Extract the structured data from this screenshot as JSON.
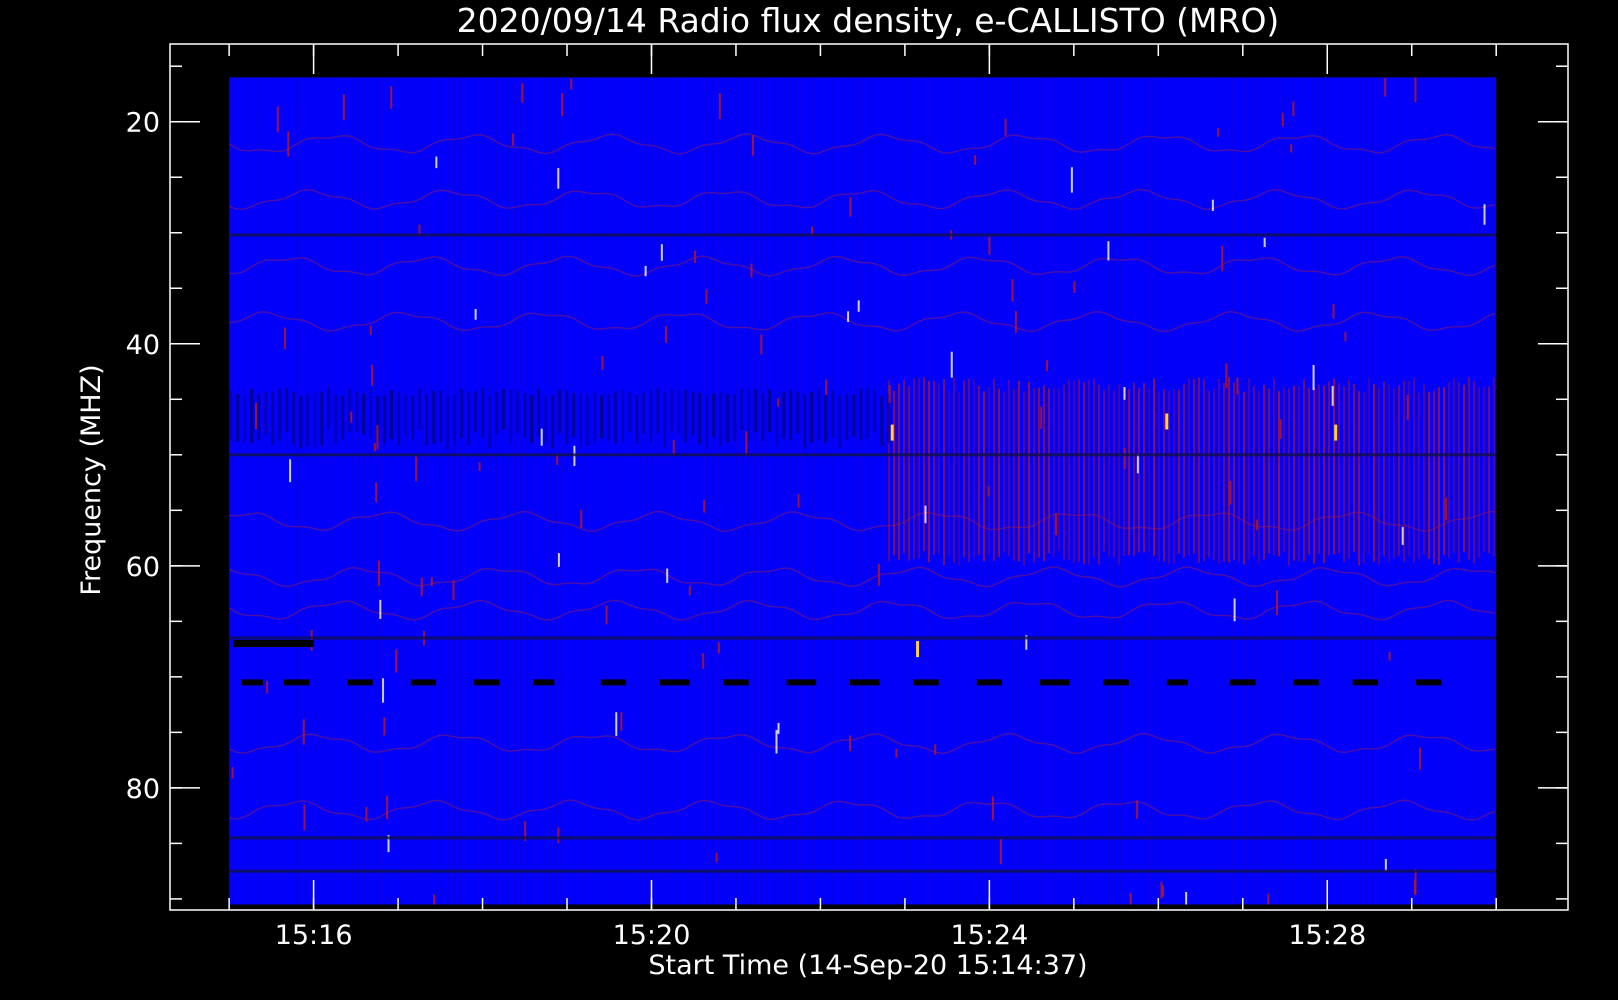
{
  "chart_data": {
    "type": "heatmap",
    "title": "2020/09/14  Radio flux density, e-CALLISTO (MRO)",
    "xlabel": "Start Time (14-Sep-20 15:14:37)",
    "ylabel": "Frequency (MHZ)",
    "x_ticks": [
      {
        "label": "15:16",
        "minutes": 16
      },
      {
        "label": "15:20",
        "minutes": 20
      },
      {
        "label": "15:24",
        "minutes": 24
      },
      {
        "label": "15:28",
        "minutes": 28
      }
    ],
    "x_minor_step_minutes": 1,
    "y_ticks": [
      {
        "label": "20",
        "value": 20
      },
      {
        "label": "40",
        "value": 40
      },
      {
        "label": "60",
        "value": 60
      },
      {
        "label": "80",
        "value": 80
      }
    ],
    "y_minor_step": 5,
    "xlim_minutes": [
      14.3,
      30.85
    ],
    "ylim_mhz": [
      91,
      13
    ],
    "data_range": {
      "start_minutes": 15.0,
      "end_minutes": 30.0,
      "freq_top_mhz": 16,
      "freq_bottom_mhz": 90.5
    },
    "colors": {
      "background": "#0000ff",
      "texture": "#1a00c8",
      "burst": "#c01818",
      "hot": "#ffd040",
      "gap": "#000000"
    },
    "features": {
      "hline_mhz": [
        30.2,
        50.0,
        66.5,
        84.5,
        87.5
      ],
      "gap_band_mhz": 70.5,
      "gap_band_segments": [
        [
          15.15,
          15.4
        ],
        [
          15.65,
          15.95
        ],
        [
          16.4,
          16.7
        ],
        [
          17.15,
          17.45
        ],
        [
          17.9,
          18.2
        ],
        [
          18.6,
          18.85
        ],
        [
          19.4,
          19.7
        ],
        [
          20.1,
          20.45
        ],
        [
          20.85,
          21.15
        ],
        [
          21.6,
          21.95
        ],
        [
          22.35,
          22.7
        ],
        [
          23.1,
          23.4
        ],
        [
          23.85,
          24.15
        ],
        [
          24.6,
          24.95
        ],
        [
          25.35,
          25.65
        ],
        [
          26.1,
          26.35
        ],
        [
          26.85,
          27.15
        ],
        [
          27.6,
          27.9
        ],
        [
          28.3,
          28.6
        ],
        [
          29.05,
          29.35
        ]
      ],
      "black_bar": {
        "mhz": 67.0,
        "start_minutes": 15.05,
        "end_minutes": 16.0
      },
      "burst_region": {
        "start_minutes": 22.8,
        "end_minutes": 30.0,
        "freq_low_mhz": 43,
        "freq_high_mhz": 60
      },
      "hot_spots": [
        {
          "minutes": 26.1,
          "mhz": 47
        },
        {
          "minutes": 22.85,
          "mhz": 48
        },
        {
          "minutes": 28.1,
          "mhz": 48
        },
        {
          "minutes": 23.15,
          "mhz": 67.5
        }
      ]
    }
  }
}
